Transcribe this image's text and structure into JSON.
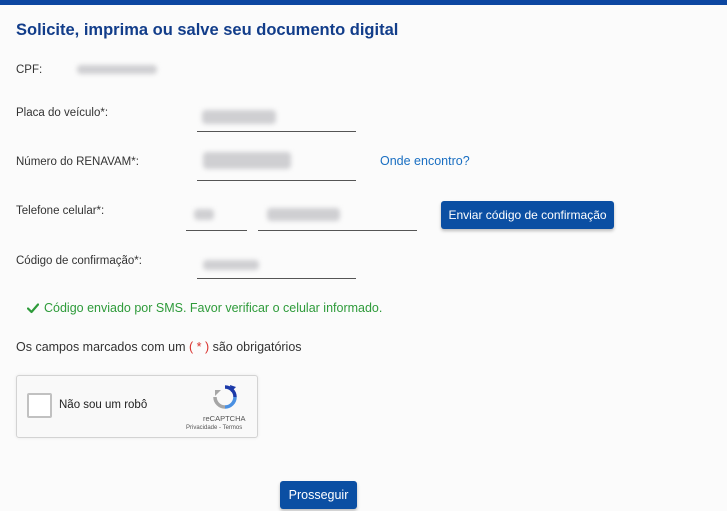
{
  "page": {
    "title": "Solicite, imprima ou salve seu documento digital"
  },
  "form": {
    "cpf_label": "CPF:",
    "placa_label": "Placa do veículo*:",
    "renavam_label": "Número do RENAVAM*:",
    "renavam_help_link": "Onde encontro?",
    "telefone_label": "Telefone celular*:",
    "enviar_codigo_button": "Enviar código de confirmação",
    "codigo_label": "Código de confirmação*:",
    "success_message": "Código enviado por SMS. Favor verificar o celular informado.",
    "required_note_prefix": "Os campos marcados com um ",
    "required_note_open": "(",
    "required_note_star": " * ",
    "required_note_close": ")",
    "required_note_suffix": " são obrigatórios"
  },
  "captcha": {
    "label": "Não sou um robô",
    "brand": "reCAPTCHA",
    "links": "Privacidade - Termos"
  },
  "actions": {
    "submit_label": "Prosseguir"
  },
  "colors": {
    "primary": "#0b4fa3",
    "title": "#123d8a",
    "link": "#1a6fc2",
    "success": "#2e9b3a",
    "required_star": "#d9302c"
  },
  "icons": {
    "success": "check-icon",
    "captcha": "recaptcha-logo-icon"
  }
}
